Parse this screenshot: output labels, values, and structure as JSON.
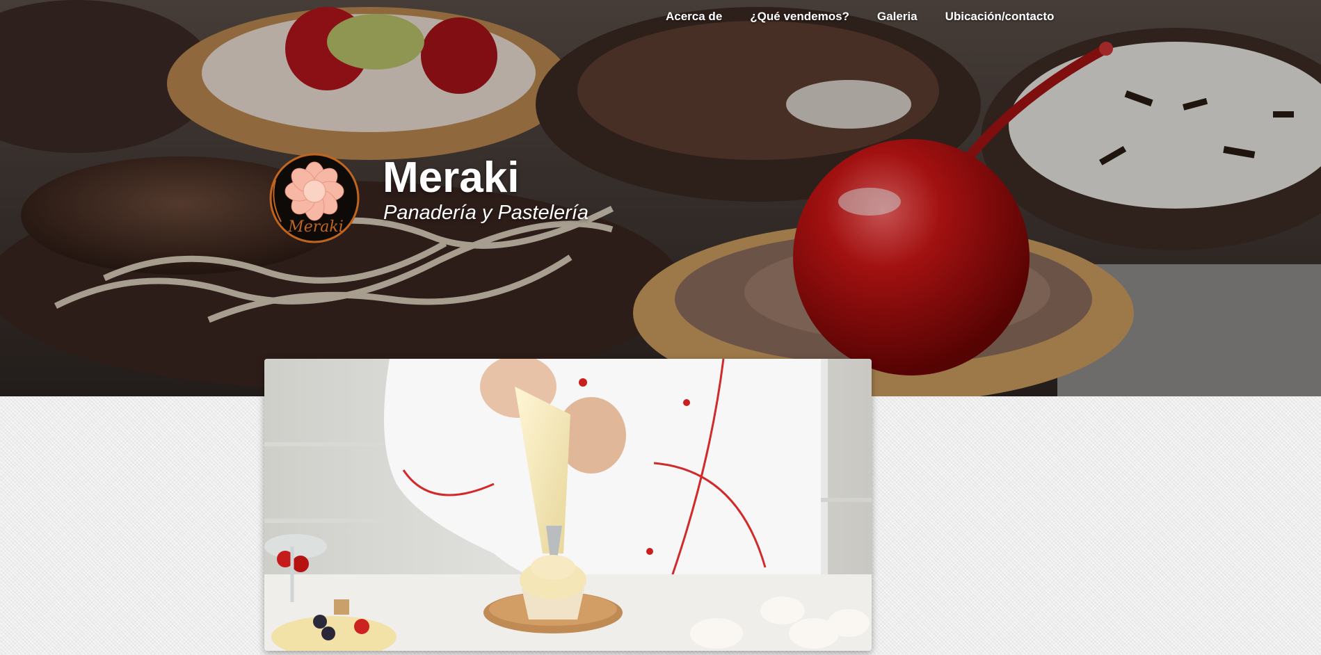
{
  "nav": {
    "items": [
      {
        "label": "Acerca de"
      },
      {
        "label": "¿Qué vendemos?"
      },
      {
        "label": "Galeria"
      },
      {
        "label": "Ubicación/contacto"
      }
    ]
  },
  "brand": {
    "title": "Meraki",
    "subtitle": "Panadería y Pastelería",
    "logo_text": "Meraki"
  },
  "hero": {
    "image": "pastry-tarts-with-cherry-photo"
  },
  "feature": {
    "image": "chef-piping-cupcake-photo"
  },
  "colors": {
    "background": "#ececec",
    "nav_text": "#ffffff",
    "logo_flower": "#f6b8a4",
    "logo_ring": "#c0651f"
  }
}
